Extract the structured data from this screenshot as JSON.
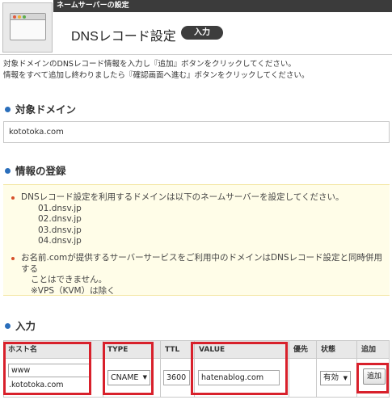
{
  "header": {
    "section_label": "ネームサーバーの設定",
    "title": "DNSレコード設定",
    "badge": "入力",
    "icon": "browser-window-icon"
  },
  "intro": {
    "line1": "対象ドメインのDNSレコード情報を入力し『追加』ボタンをクリックしてください。",
    "line2": "情報をすべて追加し終わりましたら『確認画面へ進む』ボタンをクリックしてください。"
  },
  "target_domain": {
    "heading": "対象ドメイン",
    "value": "kototoka.com"
  },
  "registration": {
    "heading": "情報の登録",
    "notice1": "DNSレコード設定を利用するドメインは以下のネームサーバーを設定してください。",
    "nameservers": [
      "01.dnsv.jp",
      "02.dnsv.jp",
      "03.dnsv.jp",
      "04.dnsv.jp"
    ],
    "notice2_line1": "お名前.comが提供するサーバーサービスをご利用中のドメインはDNSレコード設定と同時併用する",
    "notice2_line2": "ことはできません。",
    "notice2_line3": "※VPS（KVM）は除く"
  },
  "input": {
    "heading": "入力",
    "columns": {
      "host": "ホスト名",
      "type": "TYPE",
      "ttl": "TTL",
      "value": "VALUE",
      "priority": "優先",
      "status": "状態",
      "add": "追加"
    },
    "host_value": "www",
    "host_suffix": ".kototoka.com",
    "type_value": "CNAME",
    "ttl_value": "3600",
    "value_value": "hatenablog.com",
    "status_value": "有効",
    "add_button": "追加"
  },
  "colors": {
    "accent_bullet": "#2a6ebb",
    "highlight": "#d8202b",
    "header_bar": "#3b3b3b",
    "notice_bg": "#fffde8"
  }
}
